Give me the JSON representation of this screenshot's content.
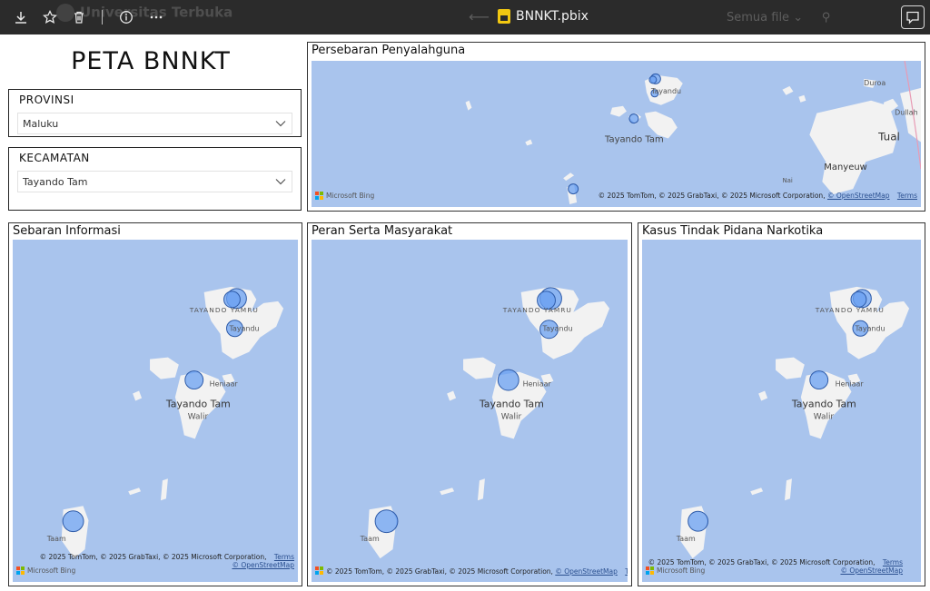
{
  "toolbar": {
    "file_name": "BNNKT.pbix",
    "icons": [
      "download-icon",
      "star-icon",
      "trash-icon",
      "info-icon",
      "more-icon",
      "comment-icon"
    ],
    "ghost_brand": "Universitas Terbuka",
    "ghost_search": "Semua file"
  },
  "report": {
    "title": "PETA BNNKT",
    "provinsi": {
      "label": "PROVINSI",
      "value": "Maluku"
    },
    "kecamatan": {
      "label": "KECAMATAN",
      "value": "Tayando Tam"
    }
  },
  "attribution": {
    "text": "© 2025 TomTom, © 2025 GrabTaxi, © 2025 Microsoft Corporation,",
    "osm": "© OpenStreetMap",
    "terms": "Terms",
    "bing": "Microsoft Bing"
  },
  "maps": {
    "persebaran": {
      "title": "Persebaran Penyalahguna",
      "labels": {
        "tayandu": "Tayandu",
        "tayando_tam": "Tayando Tam",
        "duroa": "Duroa",
        "dullah": "Dullah",
        "tual": "Tual",
        "manyeuw": "Manyeuw",
        "nai": "Nai"
      }
    },
    "sebaran": {
      "title": "Sebaran Informasi",
      "labels": {
        "tayando_yamru": "TAYANDO YAMRU",
        "tayandu": "Tayandu",
        "heniaar": "Heniaar",
        "tayando_tam": "Tayando Tam",
        "walir": "Walir",
        "taam": "Taam"
      }
    },
    "peran": {
      "title": "Peran Serta Masyarakat",
      "labels": {
        "tayando_yamru": "TAYANDO YAMRU",
        "tayandu": "Tayandu",
        "heniaar": "Heniaar",
        "tayando_tam": "Tayando Tam",
        "walir": "Walir",
        "taam": "Taam"
      }
    },
    "kasus": {
      "title": "Kasus Tindak Pidana Narkotika",
      "labels": {
        "tayando_yamru": "TAYANDO YAMRU",
        "tayandu": "Tayandu",
        "heniaar": "Heniaar",
        "tayando_tam": "Tayando Tam",
        "walir": "Walir",
        "taam": "Taam"
      }
    }
  },
  "colors": {
    "water": "#a9c4ed",
    "land": "#f2f2f2",
    "bubble": "#6aa0f2",
    "bubble_stroke": "#2d5aa8"
  }
}
